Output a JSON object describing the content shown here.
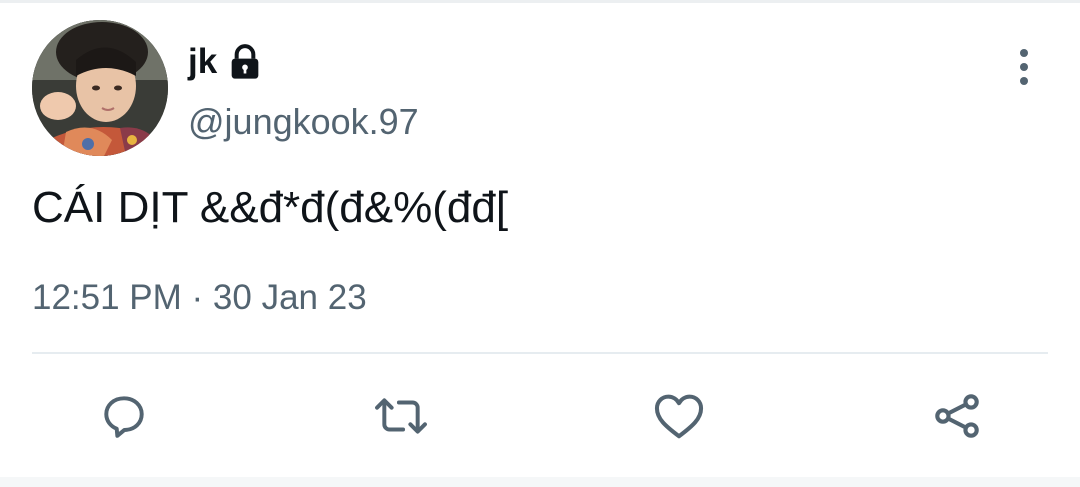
{
  "tweet": {
    "author": {
      "display_name": "jk",
      "handle": "@jungkook.97",
      "protected_icon": "lock-icon",
      "avatar": "profile-photo"
    },
    "text": "CÁI DỊT &&đ*đ(đ&%(đđ[",
    "timestamp": "12:51 PM · 30 Jan 23",
    "menu_icon": "more-vertical-icon"
  },
  "actions": [
    {
      "name": "reply",
      "icon": "reply-bubble-icon"
    },
    {
      "name": "retweet",
      "icon": "retweet-icon"
    },
    {
      "name": "like",
      "icon": "heart-icon"
    },
    {
      "name": "share",
      "icon": "share-icon"
    }
  ],
  "colors": {
    "text_primary": "#0f1419",
    "text_secondary": "#536471",
    "icon": "#536471",
    "divider": "#e6ecf0",
    "background": "#ffffff"
  }
}
